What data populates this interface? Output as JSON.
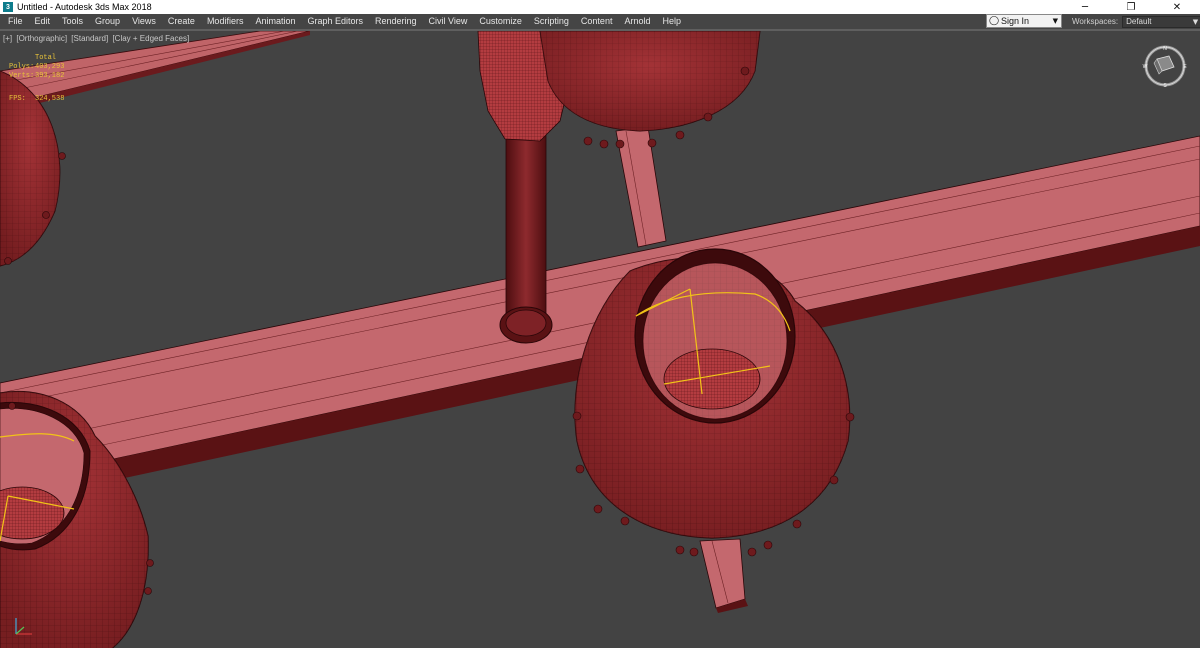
{
  "window": {
    "title": "Untitled - Autodesk 3ds Max 2018",
    "logo_text": "3"
  },
  "menu": {
    "items": [
      "File",
      "Edit",
      "Tools",
      "Group",
      "Views",
      "Create",
      "Modifiers",
      "Animation",
      "Graph Editors",
      "Rendering",
      "Civil View",
      "Customize",
      "Scripting",
      "Content",
      "Arnold",
      "Help"
    ],
    "sign_in": "Sign In",
    "workspaces_label": "Workspaces:",
    "workspaces_value": "Default"
  },
  "viewport": {
    "label_parts": [
      "[+]",
      "[Orthographic]",
      "[Standard]",
      "[Clay + Edged Faces]"
    ],
    "stats_header": "Total",
    "polys_label": "Polys:",
    "polys_value": "403,293",
    "verts_label": "Verts:",
    "verts_value": "393,182",
    "fps_label": "FPS:",
    "fps_value": "324,538",
    "viewcube_letters": {
      "n": "N",
      "e": "E",
      "s": "S",
      "w": "W"
    }
  },
  "colors": {
    "background": "#434343",
    "model_face": "#c4686e",
    "model_dark": "#6a1a1c",
    "model_mid": "#9c2f33",
    "wire": "#2a0608",
    "selection": "#f2c318",
    "stats_text": "#e8c33a"
  }
}
